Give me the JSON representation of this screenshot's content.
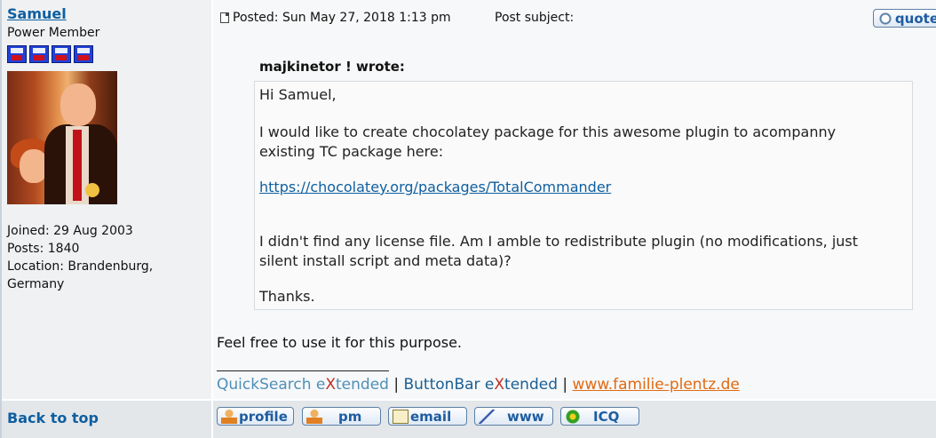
{
  "author": {
    "username": "Samuel",
    "rank": "Power Member",
    "joined": "Joined: 29 Aug 2003",
    "posts": "Posts: 1840",
    "location_line1": "Location: Brandenburg,",
    "location_line2": "Germany",
    "rank_icon": "floppy-disk-icon",
    "rank_icon_count": 4
  },
  "post": {
    "posted": "Posted: Sun May 27, 2018 1:13 pm",
    "subject": "Post subject:",
    "quote_button": "quote",
    "quote_author": "majkinetor ! wrote:",
    "quote_lines": [
      "Hi Samuel,",
      "I would like to create chocolatey package for this awesome plugin to acompanny",
      "existing TC package here:",
      "https://chocolatey.org/packages/TotalCommander",
      "I didn't find any license file. Am I amble to redistribute plugin (no modifications, just",
      "silent install script and meta data)?",
      "Thanks."
    ],
    "reply": "Feel free to use it for this purpose."
  },
  "signature": {
    "qs_prefix": "QuickSearch e",
    "qs_x": "X",
    "qs_suffix": "tended",
    "sep1": " | ",
    "bb_prefix": "ButtonBar e",
    "bb_x": "X",
    "bb_suffix": "tended",
    "sep2": " | ",
    "website": "www.familie-plentz.de"
  },
  "footer": {
    "back_to_top": "Back to top",
    "buttons": [
      "profile",
      "pm",
      "email",
      "www",
      "ICQ"
    ]
  },
  "colors": {
    "link": "#0f5fa0",
    "signature_x": "#c03020",
    "website": "#e06a12"
  }
}
